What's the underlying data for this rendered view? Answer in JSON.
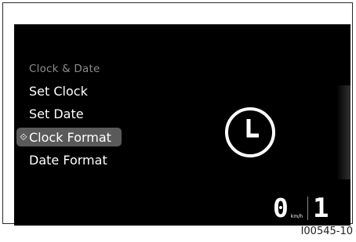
{
  "menu": {
    "header": "Clock & Date",
    "items": [
      {
        "label": "Set Clock"
      },
      {
        "label": "Set Date"
      },
      {
        "label": "Clock Format",
        "selected": true
      },
      {
        "label": "Date Format"
      }
    ],
    "selected_pointer": "⟐"
  },
  "icon": {
    "name": "clock-icon"
  },
  "status": {
    "speed": "0",
    "speed_unit": "km/h",
    "gear": "1"
  },
  "figure_ref": "I00545-10",
  "colors": {
    "display_background": "#000000",
    "highlight": "#5a5a5a",
    "text": "#ffffff",
    "header_text": "#8c8c8c"
  }
}
